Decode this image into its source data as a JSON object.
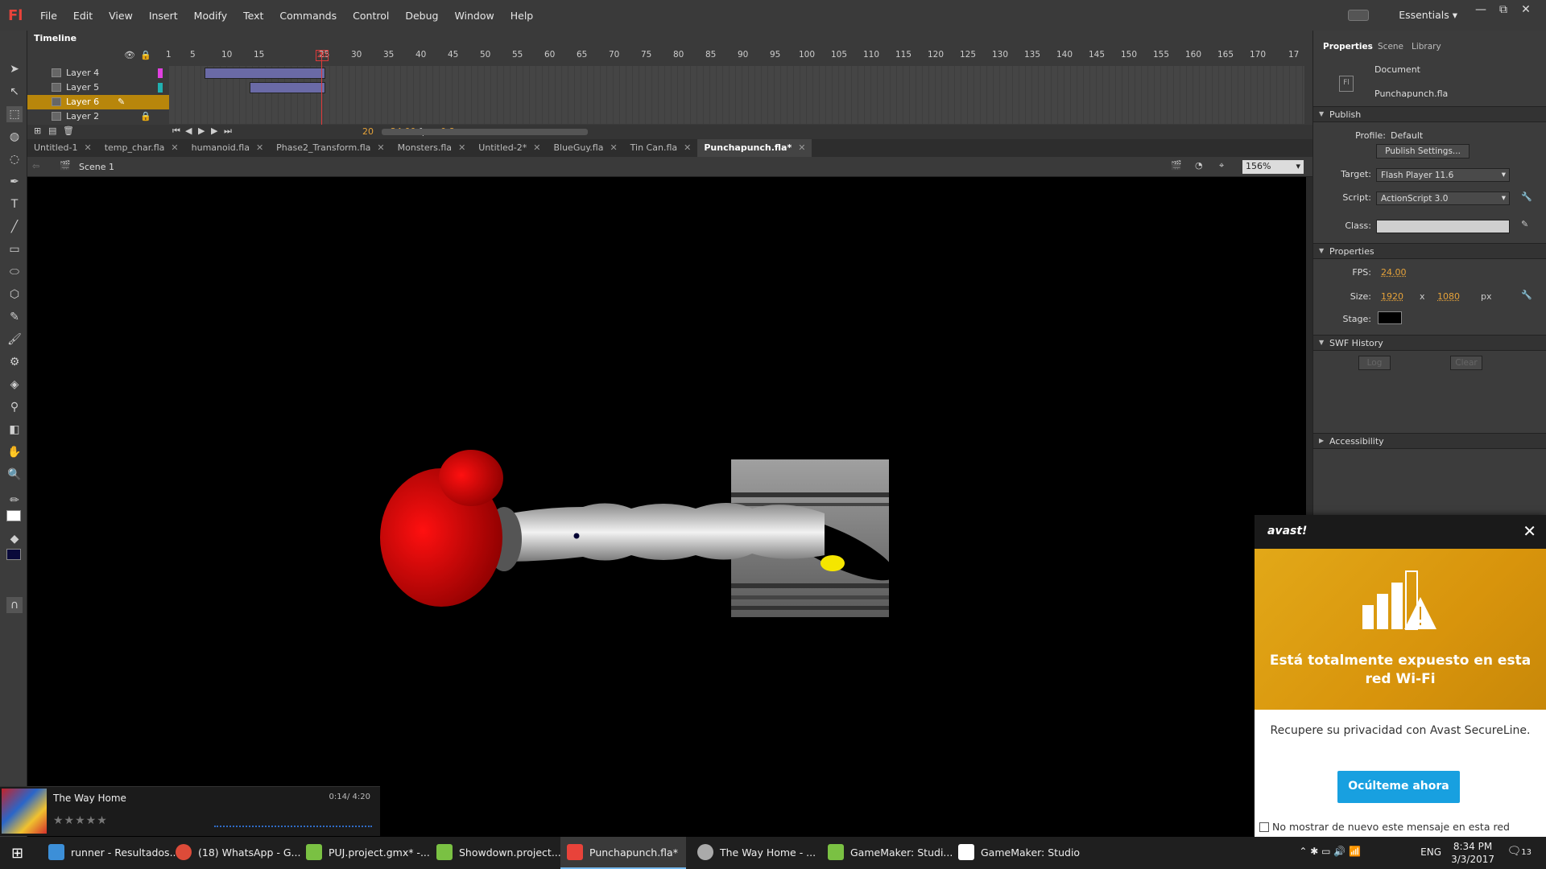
{
  "app": {
    "logo": "Fl"
  },
  "menu": [
    "File",
    "Edit",
    "View",
    "Insert",
    "Modify",
    "Text",
    "Commands",
    "Control",
    "Debug",
    "Window",
    "Help"
  ],
  "workspace": "Essentials",
  "window_controls": [
    "—",
    "⧉",
    "✕"
  ],
  "timeline": {
    "title": "Timeline",
    "ruler": [
      "1",
      "5",
      "10",
      "15",
      "20",
      "25",
      "30",
      "35",
      "40",
      "45",
      "50",
      "55",
      "60",
      "65",
      "70",
      "75",
      "80",
      "85",
      "90",
      "95",
      "100",
      "105",
      "110",
      "115",
      "120",
      "125",
      "130",
      "135",
      "140",
      "145",
      "150",
      "155",
      "160",
      "165",
      "170",
      "17"
    ],
    "playhead_frame": "20",
    "layers": [
      {
        "name": "Layer 4",
        "color": "#e040e0"
      },
      {
        "name": "Layer 5",
        "color": "#20b0b0"
      },
      {
        "name": "Layer 6",
        "color": "#b8860b"
      },
      {
        "name": "Layer 2",
        "color": "#b0b0b0"
      }
    ],
    "status_frame": "20",
    "status_fps": "24.00",
    "status_fps_unit": "fps",
    "status_time": "0.8 s"
  },
  "doc_tabs": [
    "Untitled-1",
    "temp_char.fla",
    "humanoid.fla",
    "Phase2_Transform.fla",
    "Monsters.fla",
    "Untitled-2*",
    "BlueGuy.fla",
    "Tin Can.fla",
    "Punchapunch.fla*"
  ],
  "edit_bar": {
    "scene": "Scene 1",
    "zoom": "156%"
  },
  "properties": {
    "tabs": [
      "Properties",
      "Scene",
      "Library"
    ],
    "doc_label": "Document",
    "doc_name": "Punchapunch.fla",
    "publish": {
      "header": "Publish",
      "profile_label": "Profile:",
      "profile_value": "Default",
      "settings_button": "Publish Settings...",
      "target_label": "Target:",
      "target_value": "Flash Player 11.6",
      "script_label": "Script:",
      "script_value": "ActionScript 3.0",
      "class_label": "Class:"
    },
    "props": {
      "header": "Properties",
      "fps_label": "FPS:",
      "fps_value": "24.00",
      "size_label": "Size:",
      "width": "1920",
      "x": "x",
      "height": "1080",
      "unit": "px",
      "stage_label": "Stage:",
      "stage_color": "#000000"
    },
    "swf_history": {
      "header": "SWF History",
      "log": "Log",
      "clear": "Clear"
    },
    "accessibility": "Accessibility"
  },
  "music": {
    "title": "The Way Home",
    "time": "0:14/ 4:20",
    "stars": "★★★★★"
  },
  "avast": {
    "logo": "avast!",
    "headline": "Está totalmente expuesto en esta red Wi-Fi",
    "body": "Recupere su privacidad con Avast SecureLine.",
    "cta": "Ocúlteme ahora",
    "footer": "No mostrar de nuevo este mensaje en esta red"
  },
  "taskbar": {
    "tasks": [
      {
        "label": "runner - Resultados...",
        "color": "#3c8fd8"
      },
      {
        "label": "(18) WhatsApp - G...",
        "color": "#dd4b39"
      },
      {
        "label": "PUJ.project.gmx* -...",
        "color": "#7ac143"
      },
      {
        "label": "Showdown.project....",
        "color": "#7ac143"
      },
      {
        "label": "Punchapunch.fla*",
        "color": "#e8433a"
      },
      {
        "label": "The Way Home - ...",
        "color": "#aaaaaa"
      },
      {
        "label": "GameMaker: Studi...",
        "color": "#7ac143"
      },
      {
        "label": "GameMaker: Studio",
        "color": "#ffffff"
      }
    ],
    "lang": "ENG",
    "time": "8:34 PM",
    "date": "3/3/2017",
    "notif_count": "13"
  }
}
